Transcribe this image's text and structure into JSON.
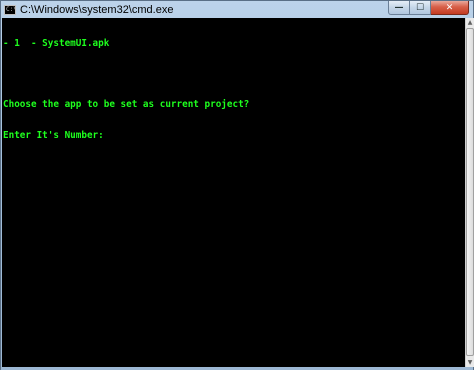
{
  "window": {
    "title": "C:\\Windows\\system32\\cmd.exe",
    "controls": {
      "minimize": "—",
      "maximize": "☐",
      "close": "✕"
    }
  },
  "console": {
    "lines": [
      "- 1  - SystemUI.apk",
      "",
      "Choose the app to be set as current project?",
      "Enter It's Number:"
    ],
    "text_color": "#1eff1e",
    "background_color": "#000000"
  },
  "scrollbar": {
    "up_arrow": "▲",
    "down_arrow": "▼"
  }
}
